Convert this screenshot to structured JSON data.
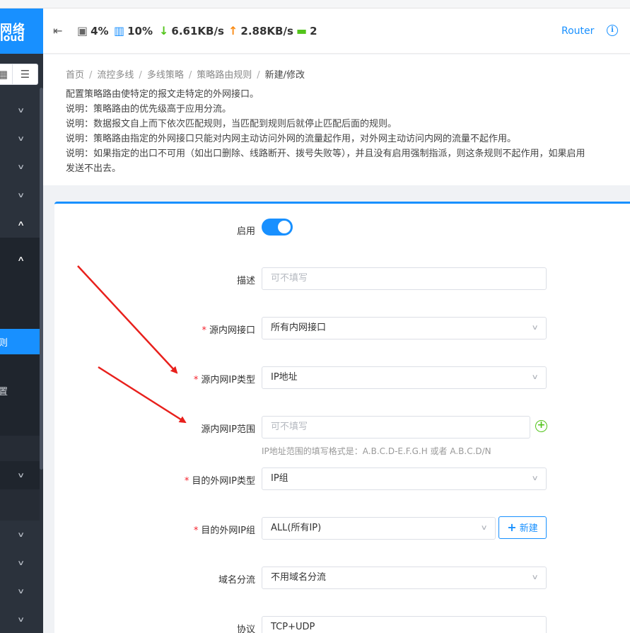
{
  "logo": {
    "line1": "网络",
    "line2": "loud"
  },
  "sidebar": {
    "active_item": "则",
    "setting_item": "置"
  },
  "header": {
    "cpu": "4%",
    "memory": "10%",
    "download": "6.61KB/s",
    "upload": "2.88KB/s",
    "online": "2",
    "router": "Router"
  },
  "breadcrumb": [
    "首页",
    "流控多线",
    "多线策略",
    "策略路由规则",
    "新建/修改"
  ],
  "description": [
    "配置策略路由使特定的报文走特定的外网接口。",
    "说明：策略路由的优先级高于应用分流。",
    "说明：数据报文自上而下依次匹配规则，当匹配到规则后就停止匹配后面的规则。",
    "说明：策略路由指定的外网接口只能对内网主动访问外网的流量起作用，对外网主动访问内网的流量不起作用。",
    "说明：如果指定的出口不可用（如出口删除、线路断开、拨号失败等），并且没有启用强制指派，则这条规则不起作用，如果启用",
    "发送不出去。"
  ],
  "form": {
    "enable_label": "启用",
    "enabled": true,
    "desc_label": "描述",
    "desc_placeholder": "可不填写",
    "src_iface_label": "源内网接口",
    "src_iface_value": "所有内网接口",
    "src_ip_type_label": "源内网IP类型",
    "src_ip_type_value": "IP地址",
    "src_ip_range_label": "源内网IP范围",
    "src_ip_range_placeholder": "可不填写",
    "src_ip_range_hint": "IP地址范围的填写格式是：A.B.C.D-E.F.G.H 或者 A.B.C.D/N",
    "dst_ip_type_label": "目的外网IP类型",
    "dst_ip_type_value": "IP组",
    "dst_ip_group_label": "目的外网IP组",
    "dst_ip_group_value": "ALL(所有IP)",
    "new_button": "新建",
    "domain_label": "域名分流",
    "domain_value": "不用域名分流",
    "protocol_label": "协议",
    "protocol_value": "TCP+UDP"
  },
  "colors": {
    "primary": "#1890ff",
    "sidebar": "#2b323c",
    "required": "#f5222d",
    "arrow": "#e8201c",
    "add": "#52c41a"
  }
}
